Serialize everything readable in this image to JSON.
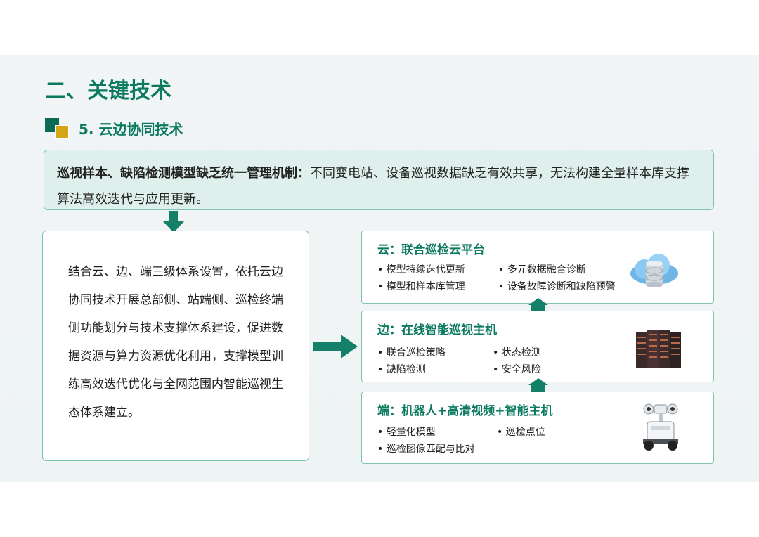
{
  "heading": "二、关键技术",
  "subheading": "5. 云边协同技术",
  "problem": {
    "label": "巡视样本、缺陷检测模型缺乏统一管理机制：",
    "text": "不同变电站、设备巡视数据缺乏有效共享，无法构建全量样本库支撑算法高效迭代与应用更新。"
  },
  "description": "结合云、边、端三级体系设置，依托云边协同技术开展总部侧、站端侧、巡检终端侧功能划分与技术支撑体系建设，促进数据资源与算力资源优化利用，支撑模型训练高效迭代优化与全网范围内智能巡视生态体系建立。",
  "cloud": {
    "title": "云：联合巡检云平台",
    "items": [
      "• 模型持续迭代更新",
      "• 多元数据融合诊断",
      "• 模型和样本库管理",
      "• 设备故障诊断和缺陷预警"
    ],
    "icon": "cloud-database-icon"
  },
  "edge": {
    "title": "边：在线智能巡视主机",
    "items": [
      "• 联合巡检策略",
      "• 状态检测",
      "• 缺陷检测",
      "• 安全风险"
    ],
    "icon": "server-rack-icon"
  },
  "terminal": {
    "title": "端：机器人+高清视频+智能主机",
    "items": [
      "• 轻量化模型",
      "• 巡检点位",
      "• 巡检图像匹配与比对"
    ],
    "icon": "inspection-robot-icon"
  },
  "colors": {
    "accent": "#0b7a5f",
    "arrow": "#14806a",
    "gold": "#d4a514",
    "border": "#7fc3b3"
  }
}
